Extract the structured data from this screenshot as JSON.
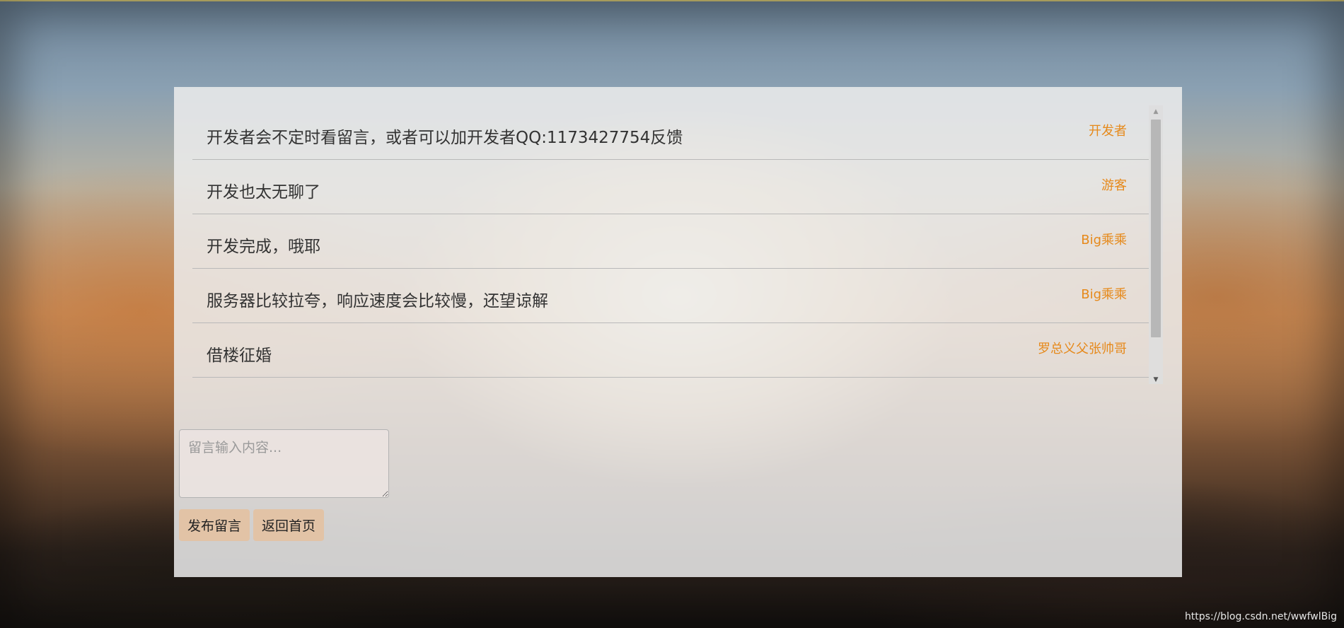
{
  "messages": [
    {
      "text": "开发者会不定时看留言，或者可以加开发者QQ:1173427754反馈",
      "author": "开发者"
    },
    {
      "text": "开发也太无聊了",
      "author": "游客"
    },
    {
      "text": "开发完成，哦耶",
      "author": "Big乘乘"
    },
    {
      "text": "服务器比较拉夸，响应速度会比较慢，还望谅解",
      "author": "Big乘乘"
    },
    {
      "text": "借楼征婚",
      "author": "罗总义父张帅哥"
    }
  ],
  "input": {
    "placeholder": "留言输入内容..."
  },
  "buttons": {
    "post_label": "发布留言",
    "home_label": "返回首页"
  },
  "watermark": "https://blog.csdn.net/wwfwlBig",
  "colors": {
    "author": "#e6891a",
    "button_bg": "#e2c3a6",
    "panel_bg": "#ececec"
  }
}
